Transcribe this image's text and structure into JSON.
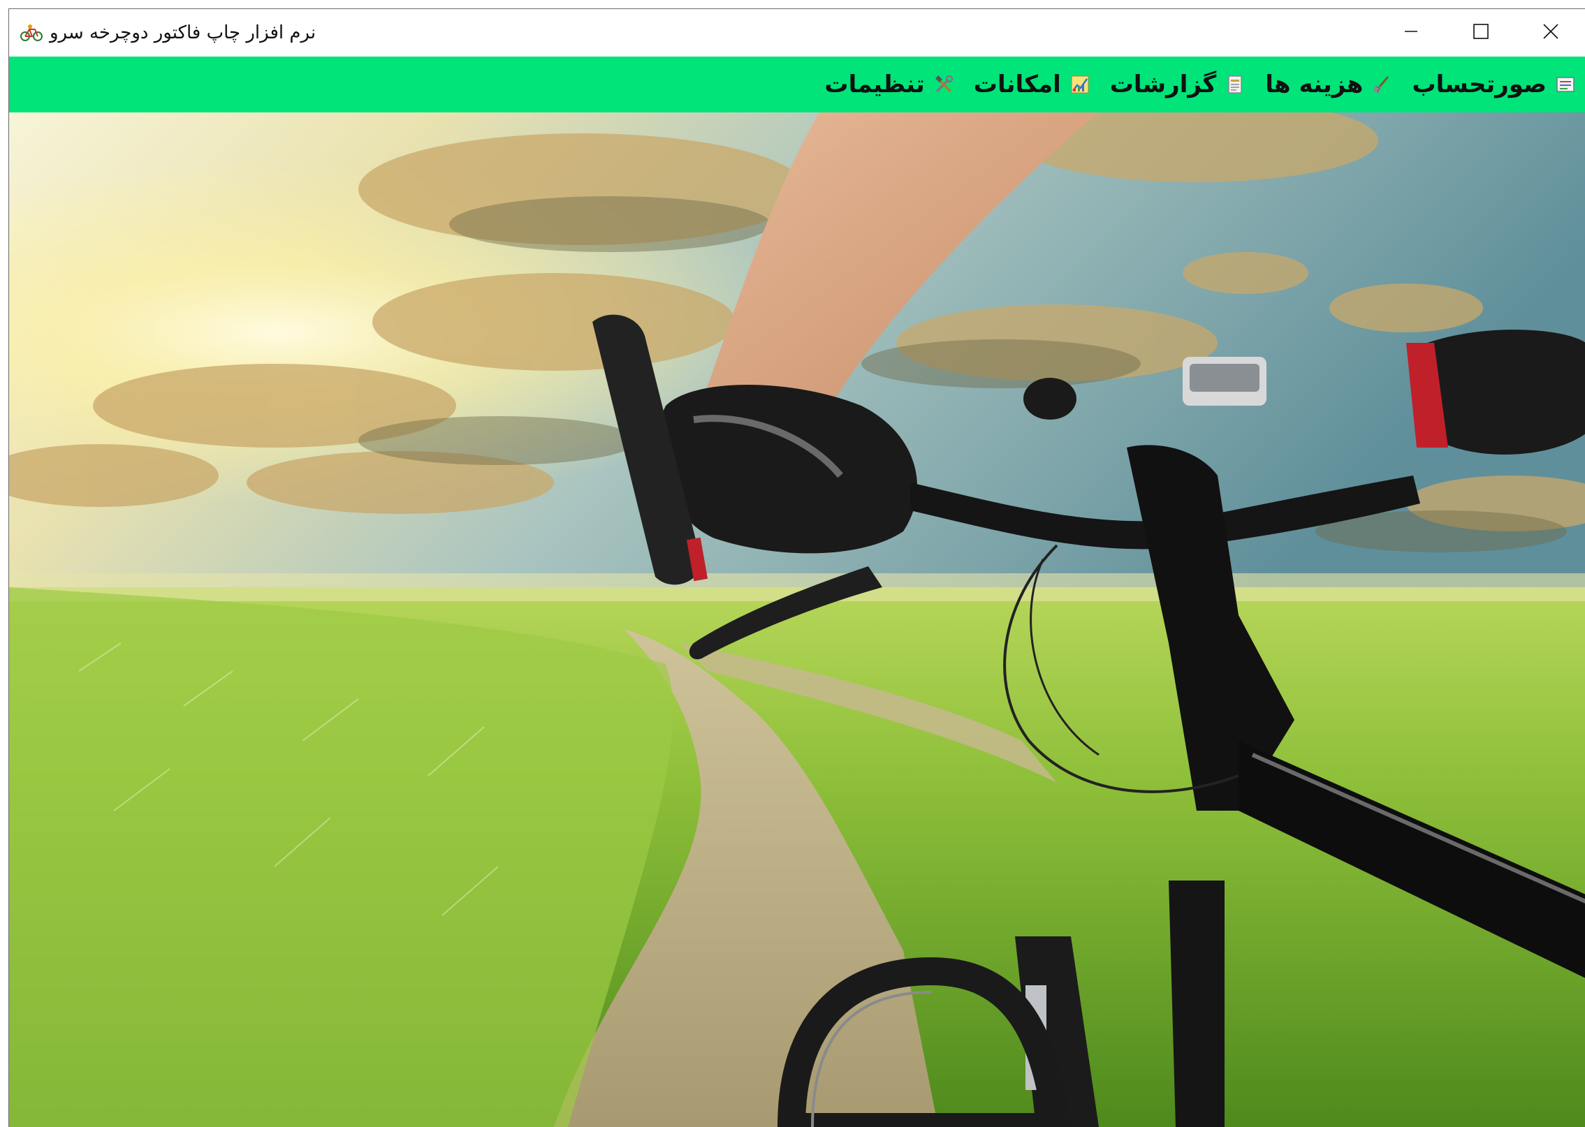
{
  "window": {
    "title": "نرم افزار چاپ فاکتور دوچرخه سرو",
    "app_icon": "bicycle-icon",
    "controls": {
      "minimize_icon": "minimize-icon",
      "maximize_icon": "maximize-icon",
      "close_icon": "close-icon"
    }
  },
  "menubar": {
    "background_color": "#00e47a",
    "items": [
      {
        "label": "صورتحساب",
        "icon": "invoice-icon"
      },
      {
        "label": "هزینه ها",
        "icon": "broom-icon"
      },
      {
        "label": "گزارشات",
        "icon": "report-icon"
      },
      {
        "label": "امکانات",
        "icon": "chart-icon"
      },
      {
        "label": "تنظیمات",
        "icon": "tools-icon"
      }
    ]
  },
  "background": {
    "image": "cyclist-handlebar-landscape"
  }
}
